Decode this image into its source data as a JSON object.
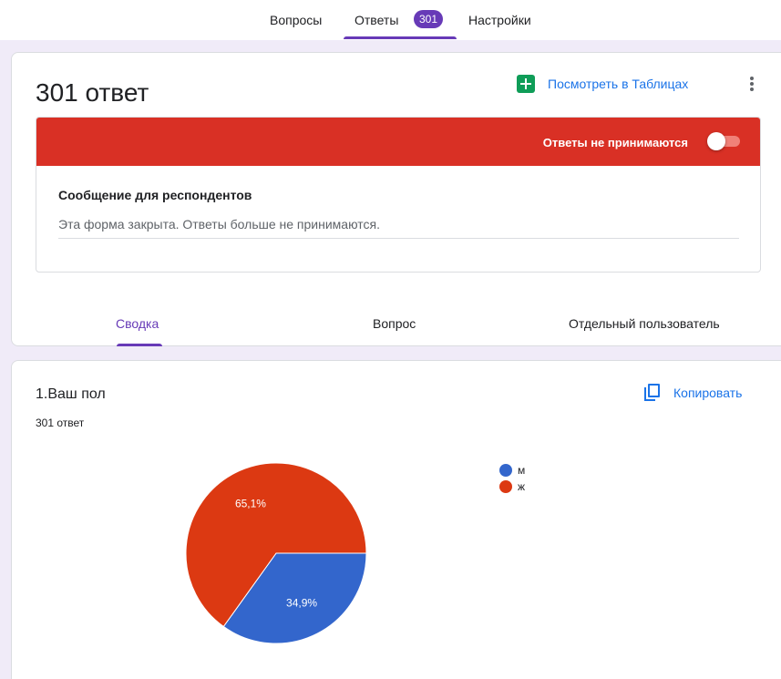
{
  "nav": {
    "tabs": [
      {
        "label": "Вопросы"
      },
      {
        "label": "Ответы"
      },
      {
        "label": "Настройки"
      }
    ],
    "responses_badge": "301"
  },
  "summary": {
    "title": "301 ответ",
    "sheets_label": "Посмотреть в Таблицах",
    "more_icon": "more-vert-icon",
    "sheets_icon": "google-sheets-icon"
  },
  "closed": {
    "banner_label": "Ответы не принимаются",
    "accepting": false,
    "message_title": "Сообщение для респондентов",
    "message_value": "Эта форма закрыта. Ответы больше не принимаются.",
    "banner_color": "#d93025"
  },
  "subtabs": [
    {
      "label": "Сводка",
      "active": true
    },
    {
      "label": "Вопрос",
      "active": false
    },
    {
      "label": "Отдельный пользователь",
      "active": false
    }
  ],
  "question": {
    "title": "1.Ваш пол",
    "count": "301 ответ",
    "copy_label": "Копировать",
    "copy_icon": "content-copy-icon"
  },
  "chart_data": {
    "type": "pie",
    "categories": [
      "м",
      "ж"
    ],
    "values": [
      34.9,
      65.1
    ],
    "value_labels": [
      "34,9%",
      "65,1%"
    ],
    "colors": [
      "#3366cc",
      "#dc3912"
    ],
    "legend_position": "right"
  },
  "colors": {
    "accent": "#673ab7",
    "link": "#1a73e8"
  }
}
